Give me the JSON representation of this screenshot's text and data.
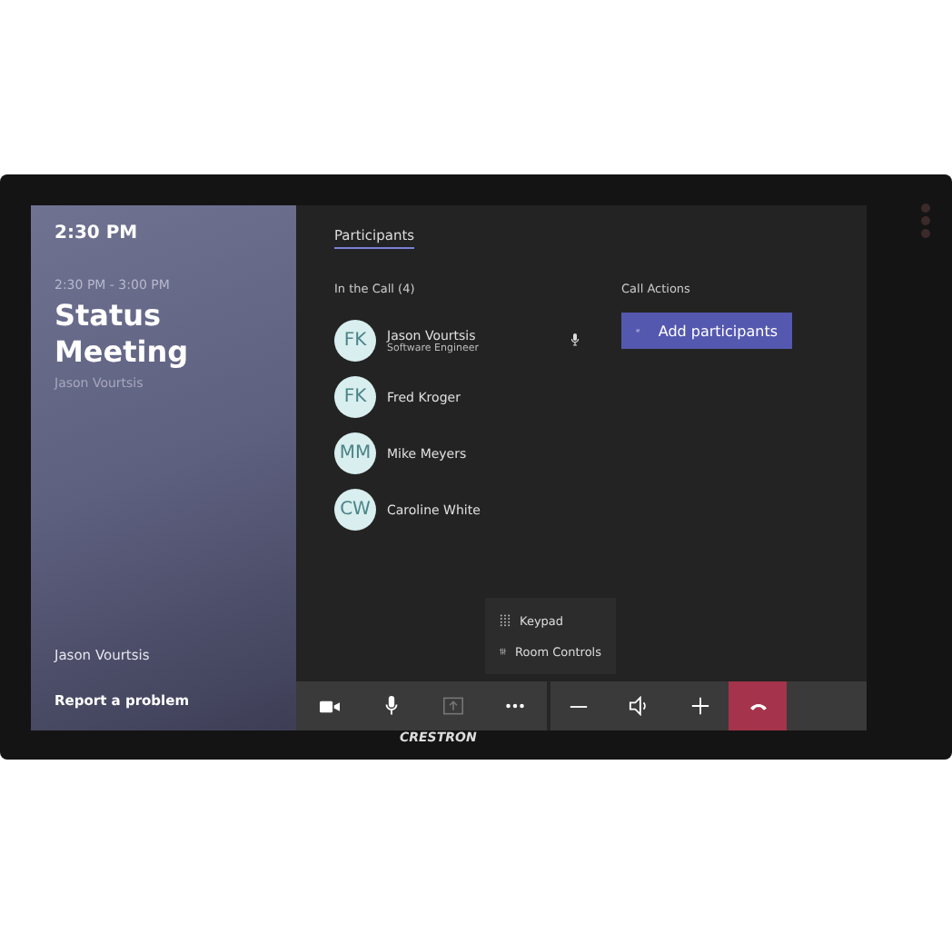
{
  "sidebar": {
    "clock": "2:30 PM",
    "meeting_time": "2:30 PM - 3:00 PM",
    "meeting_title": "Status Meeting",
    "organizer": "Jason Vourtsis",
    "user": "Jason Vourtsis",
    "report_link": "Report a problem"
  },
  "tabs": [
    {
      "label": "Participants",
      "selected": true
    }
  ],
  "in_call": {
    "heading": "In the Call (4)",
    "participants": [
      {
        "initials": "FK",
        "name": "Jason Vourtsis",
        "role": "Software Engineer",
        "speaking": true
      },
      {
        "initials": "FK",
        "name": "Fred Kroger",
        "speaking": false
      },
      {
        "initials": "MM",
        "name": "Mike Meyers",
        "speaking": false
      },
      {
        "initials": "CW",
        "name": "Caroline White",
        "speaking": false
      }
    ]
  },
  "call_actions": {
    "heading": "Call Actions",
    "button": "Add participants"
  },
  "more_menu": [
    {
      "kind": "keypad",
      "label": "Keypad"
    },
    {
      "kind": "sliders",
      "label": "Room Controls"
    }
  ],
  "toolbar": [
    {
      "kind": "camera",
      "disabled": false
    },
    {
      "kind": "mic",
      "disabled": false
    },
    {
      "kind": "share",
      "disabled": true
    },
    {
      "kind": "more",
      "disabled": false
    },
    {
      "kind": "minus",
      "disabled": false
    },
    {
      "kind": "speaker",
      "disabled": false
    },
    {
      "kind": "plus",
      "disabled": false
    },
    {
      "kind": "hangup",
      "disabled": false
    }
  ],
  "device": {
    "brand": "CRESTRON"
  }
}
